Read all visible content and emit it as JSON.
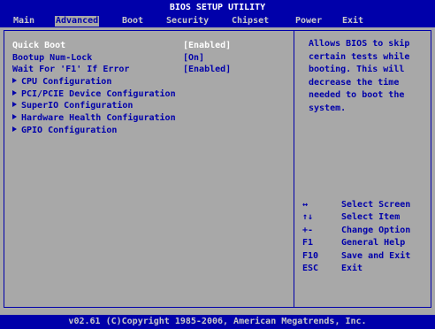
{
  "title": "BIOS SETUP UTILITY",
  "menu": {
    "items": [
      {
        "label": "Main"
      },
      {
        "label": "Advanced"
      },
      {
        "label": "Boot"
      },
      {
        "label": "Security"
      },
      {
        "label": "Chipset"
      },
      {
        "label": "Power"
      },
      {
        "label": "Exit"
      }
    ],
    "active": "Advanced"
  },
  "options": [
    {
      "label": "Quick Boot",
      "value": "[Enabled]",
      "selected": true
    },
    {
      "label": "Bootup Num-Lock",
      "value": "[On]",
      "selected": false
    },
    {
      "label": "Wait For 'F1' If Error",
      "value": "[Enabled]",
      "selected": false
    }
  ],
  "submenus": [
    {
      "label": "CPU Configuration"
    },
    {
      "label": "PCI/PCIE Device Configuration"
    },
    {
      "label": "SuperIO Configuration"
    },
    {
      "label": "Hardware Health Configuration"
    },
    {
      "label": "GPIO Configuration"
    }
  ],
  "help": {
    "text": "Allows BIOS to skip\ncertain tests while\nbooting. This will\ndecrease the time\nneeded to boot the\nsystem."
  },
  "keys": [
    {
      "key": "↔",
      "desc": "Select Screen"
    },
    {
      "key": "↑↓",
      "desc": "Select Item"
    },
    {
      "key": "+-",
      "desc": "Change Option"
    },
    {
      "key": "F1",
      "desc": "General Help"
    },
    {
      "key": "F10",
      "desc": "Save and Exit"
    },
    {
      "key": "ESC",
      "desc": "Exit"
    }
  ],
  "footer": "v02.61 (C)Copyright 1985-2006, American Megatrends, Inc.",
  "colors": {
    "background": "#a8a8a8",
    "bar": "#0000aa",
    "text": "#0000aa",
    "selected_text": "#ffffff"
  }
}
